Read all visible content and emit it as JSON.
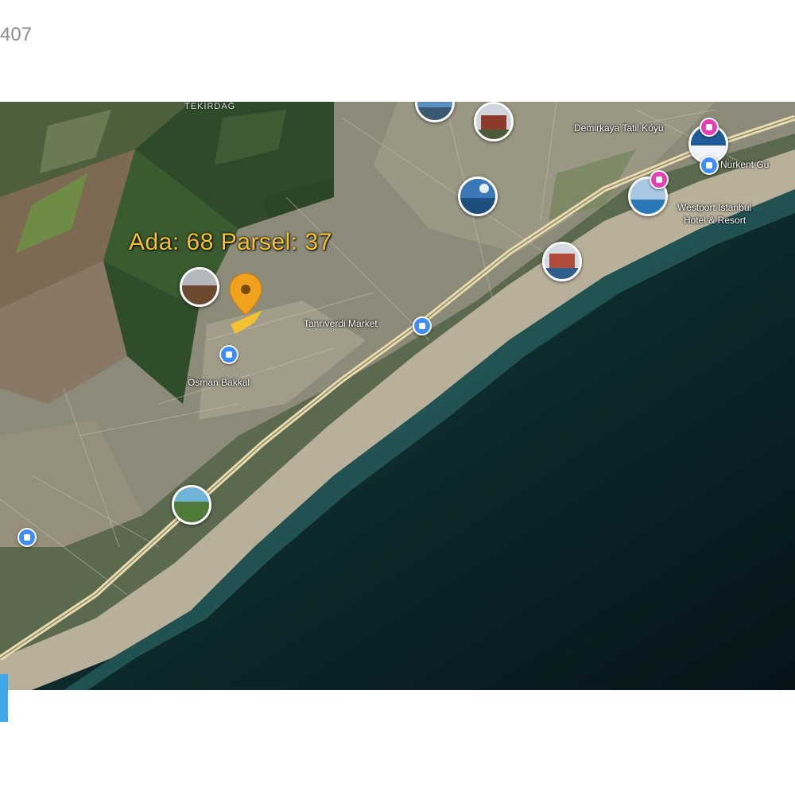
{
  "listing": {
    "id_partial": "407"
  },
  "map": {
    "plot_label": "Ada: 68  Parsel: 37",
    "places": {
      "tekirdag": "TEKİRDAĞ",
      "demirkaya": "Demirkaya Tatil Köyü",
      "nurkent": "Nurkent Gü",
      "westport_line1": "Westport Istanbul",
      "westport_line2": "Hotel & Resort",
      "tanriverdi": "Tanrıverdi Market",
      "osman": "Osman Bakkal"
    },
    "colors": {
      "label_gold": "#f2c230",
      "pin": "#f0a21c",
      "poi_blue": "#3f8ef5",
      "poi_pink": "#e43fb4",
      "sea": "#0e2b2c"
    }
  }
}
